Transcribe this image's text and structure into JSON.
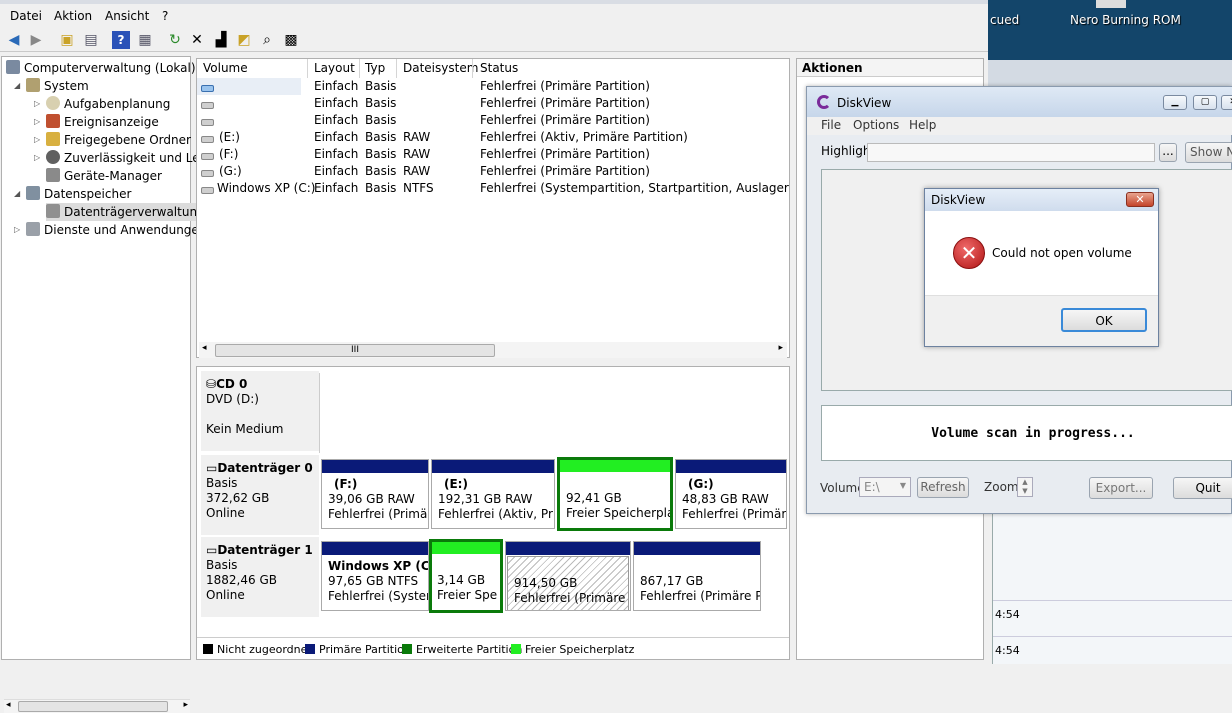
{
  "menubar": {
    "items": [
      "Datei",
      "Aktion",
      "Ansicht",
      "?"
    ]
  },
  "tree": {
    "root": "Computerverwaltung (Lokal)",
    "system": "System",
    "aufgaben": "Aufgabenplanung",
    "ereignis": "Ereignisanzeige",
    "freigegeben": "Freigegebene Ordner",
    "zuverl": "Zuverlässigkeit und Leis",
    "geraete": "Geräte-Manager",
    "datenspeicher": "Datenspeicher",
    "datentraeger": "Datenträgerverwaltung",
    "dienste": "Dienste und Anwendungen"
  },
  "volumes": {
    "columns": [
      "Volume",
      "Layout",
      "Typ",
      "Dateisystem",
      "Status"
    ],
    "rows": [
      {
        "volume": "",
        "layout": "Einfach",
        "typ": "Basis",
        "fs": "",
        "status": "Fehlerfrei (Primäre Partition)"
      },
      {
        "volume": "",
        "layout": "Einfach",
        "typ": "Basis",
        "fs": "",
        "status": "Fehlerfrei (Primäre Partition)"
      },
      {
        "volume": "",
        "layout": "Einfach",
        "typ": "Basis",
        "fs": "",
        "status": "Fehlerfrei (Primäre Partition)"
      },
      {
        "volume": "(E:)",
        "layout": "Einfach",
        "typ": "Basis",
        "fs": "RAW",
        "status": "Fehlerfrei (Aktiv, Primäre Partition)"
      },
      {
        "volume": "(F:)",
        "layout": "Einfach",
        "typ": "Basis",
        "fs": "RAW",
        "status": "Fehlerfrei (Primäre Partition)"
      },
      {
        "volume": "(G:)",
        "layout": "Einfach",
        "typ": "Basis",
        "fs": "RAW",
        "status": "Fehlerfrei (Primäre Partition)"
      },
      {
        "volume": "Windows XP (C:)",
        "layout": "Einfach",
        "typ": "Basis",
        "fs": "NTFS",
        "status": "Fehlerfrei (Systempartition, Startpartition, Auslagerungsdatei"
      }
    ],
    "scroll_thumb": "III"
  },
  "disks": {
    "cd0": {
      "name": "CD 0",
      "type": "DVD (D:)",
      "status": "Kein Medium"
    },
    "disk0": {
      "name": "Datenträger 0",
      "type": "Basis",
      "size": "372,62 GB",
      "status": "Online",
      "parts": [
        {
          "label": "(F:)",
          "size": "39,06 GB RAW",
          "status": "Fehlerfrei (Primäre"
        },
        {
          "label": "(E:)",
          "size": "192,31 GB RAW",
          "status": "Fehlerfrei (Aktiv, Prim"
        },
        {
          "label": "",
          "size": "92,41 GB",
          "status": "Freier Speicherplat"
        },
        {
          "label": "(G:)",
          "size": "48,83 GB RAW",
          "status": "Fehlerfrei (Primäre"
        }
      ]
    },
    "disk1": {
      "name": "Datenträger 1",
      "type": "Basis",
      "size": "1882,46 GB",
      "status": "Online",
      "parts": [
        {
          "label": "Windows XP  (C:)",
          "size": "97,65 GB NTFS",
          "status": "Fehlerfrei (System"
        },
        {
          "label": "",
          "size": "3,14 GB",
          "status": "Freier Spe"
        },
        {
          "label": "",
          "size": "914,50 GB",
          "status": "Fehlerfrei (Primäre Pa"
        },
        {
          "label": "",
          "size": "867,17 GB",
          "status": "Fehlerfrei (Primäre Pa"
        }
      ]
    }
  },
  "legend": [
    "Nicht zugeordnet",
    "Primäre Partition",
    "Erweiterte Partition",
    "Freier Speicherplatz"
  ],
  "legend_colors": [
    "#000000",
    "#0a1a78",
    "#0a7a0a",
    "#22ee22"
  ],
  "actions": {
    "title": "Aktionen"
  },
  "desktop": {
    "icon1": "cued",
    "icon2": "Nero Burning ROM",
    "time1": "4:54",
    "time2": "4:54"
  },
  "diskview": {
    "title": "DiskView",
    "menu": [
      "File",
      "Options",
      "Help"
    ],
    "highlight_label": "Highlight:",
    "browse": "...",
    "show_next": "Show Ne",
    "scan_text": "Volume scan in progress...",
    "volume_label": "Volume:",
    "volume_value": "E:\\",
    "refresh": "Refresh",
    "zoom_label": "Zoom:",
    "export": "Export...",
    "quit": "Quit"
  },
  "dialog": {
    "title": "DiskView",
    "message": "Could not open volume",
    "ok": "OK"
  }
}
